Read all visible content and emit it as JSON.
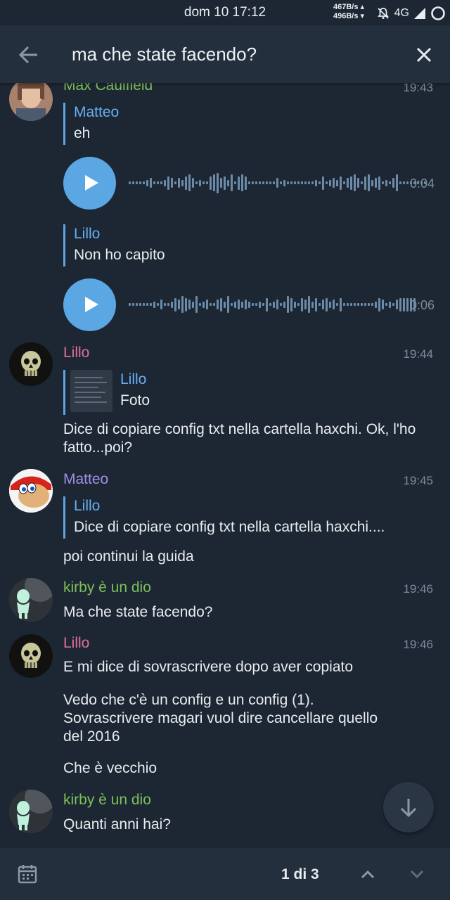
{
  "status": {
    "time": "dom 10 17:12",
    "net_up": "467B/s",
    "net_down": "496B/s",
    "network": "4G"
  },
  "search": {
    "query": "ma che state facendo?"
  },
  "messages": [
    {
      "sender": "Max Caulfield",
      "time": "19:43",
      "sender_color": "#7cc05a",
      "reply1_name": "Matteo",
      "reply1_text": "eh",
      "voice1_duration": "0:04",
      "reply2_name": "Lillo",
      "reply2_text": "Non ho capito",
      "voice2_duration": "0:06"
    },
    {
      "sender": "Lillo",
      "time": "19:44",
      "sender_color": "#e0709a",
      "reply_name": "Lillo",
      "reply_text": "Foto",
      "text": "Dice di copiare config txt nella cartella haxchi. Ok, l'ho fatto...poi?"
    },
    {
      "sender": "Matteo",
      "time": "19:45",
      "sender_color": "#9d8ee8",
      "reply_name": "Lillo",
      "reply_text": "Dice di copiare config txt nella cartella haxchi....",
      "text": "poi continui la guida"
    },
    {
      "sender": "kirby è un dio",
      "time": "19:46",
      "sender_color": "#7cc05a",
      "text": "Ma che state facendo?"
    },
    {
      "sender": "Lillo",
      "time": "19:46",
      "sender_color": "#e0709a",
      "text1": "E mi dice di sovrascrivere dopo aver copiato",
      "text2": "Vedo che c'è un config e un config (1). Sovrascrivere magari vuol dire cancellare quello del 2016",
      "text3": "Che è vecchio"
    },
    {
      "sender": "kirby è un dio",
      "sender_color": "#7cc05a",
      "text": "Quanti anni hai?"
    }
  ],
  "footer": {
    "counter": "1 di 3"
  }
}
